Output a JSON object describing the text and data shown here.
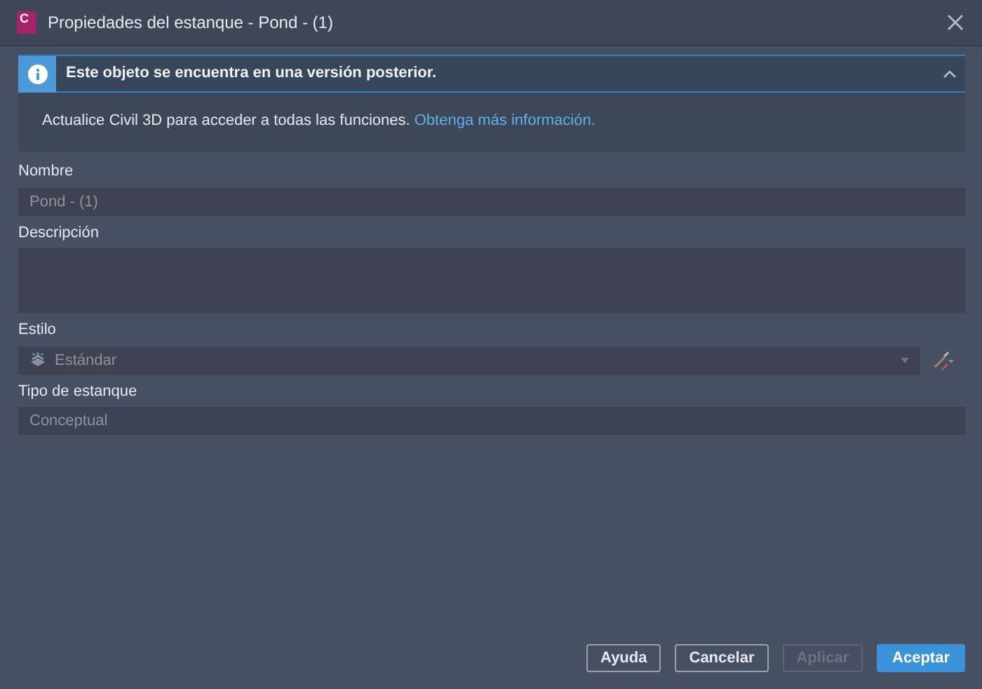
{
  "window": {
    "title": "Propiedades del estanque - Pond - (1)",
    "app_icon_letter": "C"
  },
  "banner": {
    "title": "Este objeto se encuentra en una versión posterior.",
    "expanded": true,
    "message": "Actualice Civil 3D para acceder a todas las funciones.",
    "link": "Obtenga más información."
  },
  "fields": [
    {
      "kind": "text",
      "label": "Nombre",
      "value": "Pond - (1)"
    },
    {
      "kind": "textarea",
      "label": "Descripción"
    },
    {
      "kind": "select",
      "label": "Estilo",
      "value": "Estándar"
    },
    {
      "kind": "text",
      "label": "Tipo de estanque",
      "value": "Conceptual"
    }
  ],
  "buttons": [
    {
      "label": "Ayuda",
      "kind": "default",
      "disabled": false
    },
    {
      "label": "Cancelar",
      "kind": "default",
      "disabled": false
    },
    {
      "label": "Aplicar",
      "kind": "default",
      "disabled": true
    },
    {
      "label": "Aceptar",
      "kind": "primary",
      "disabled": false
    }
  ]
}
